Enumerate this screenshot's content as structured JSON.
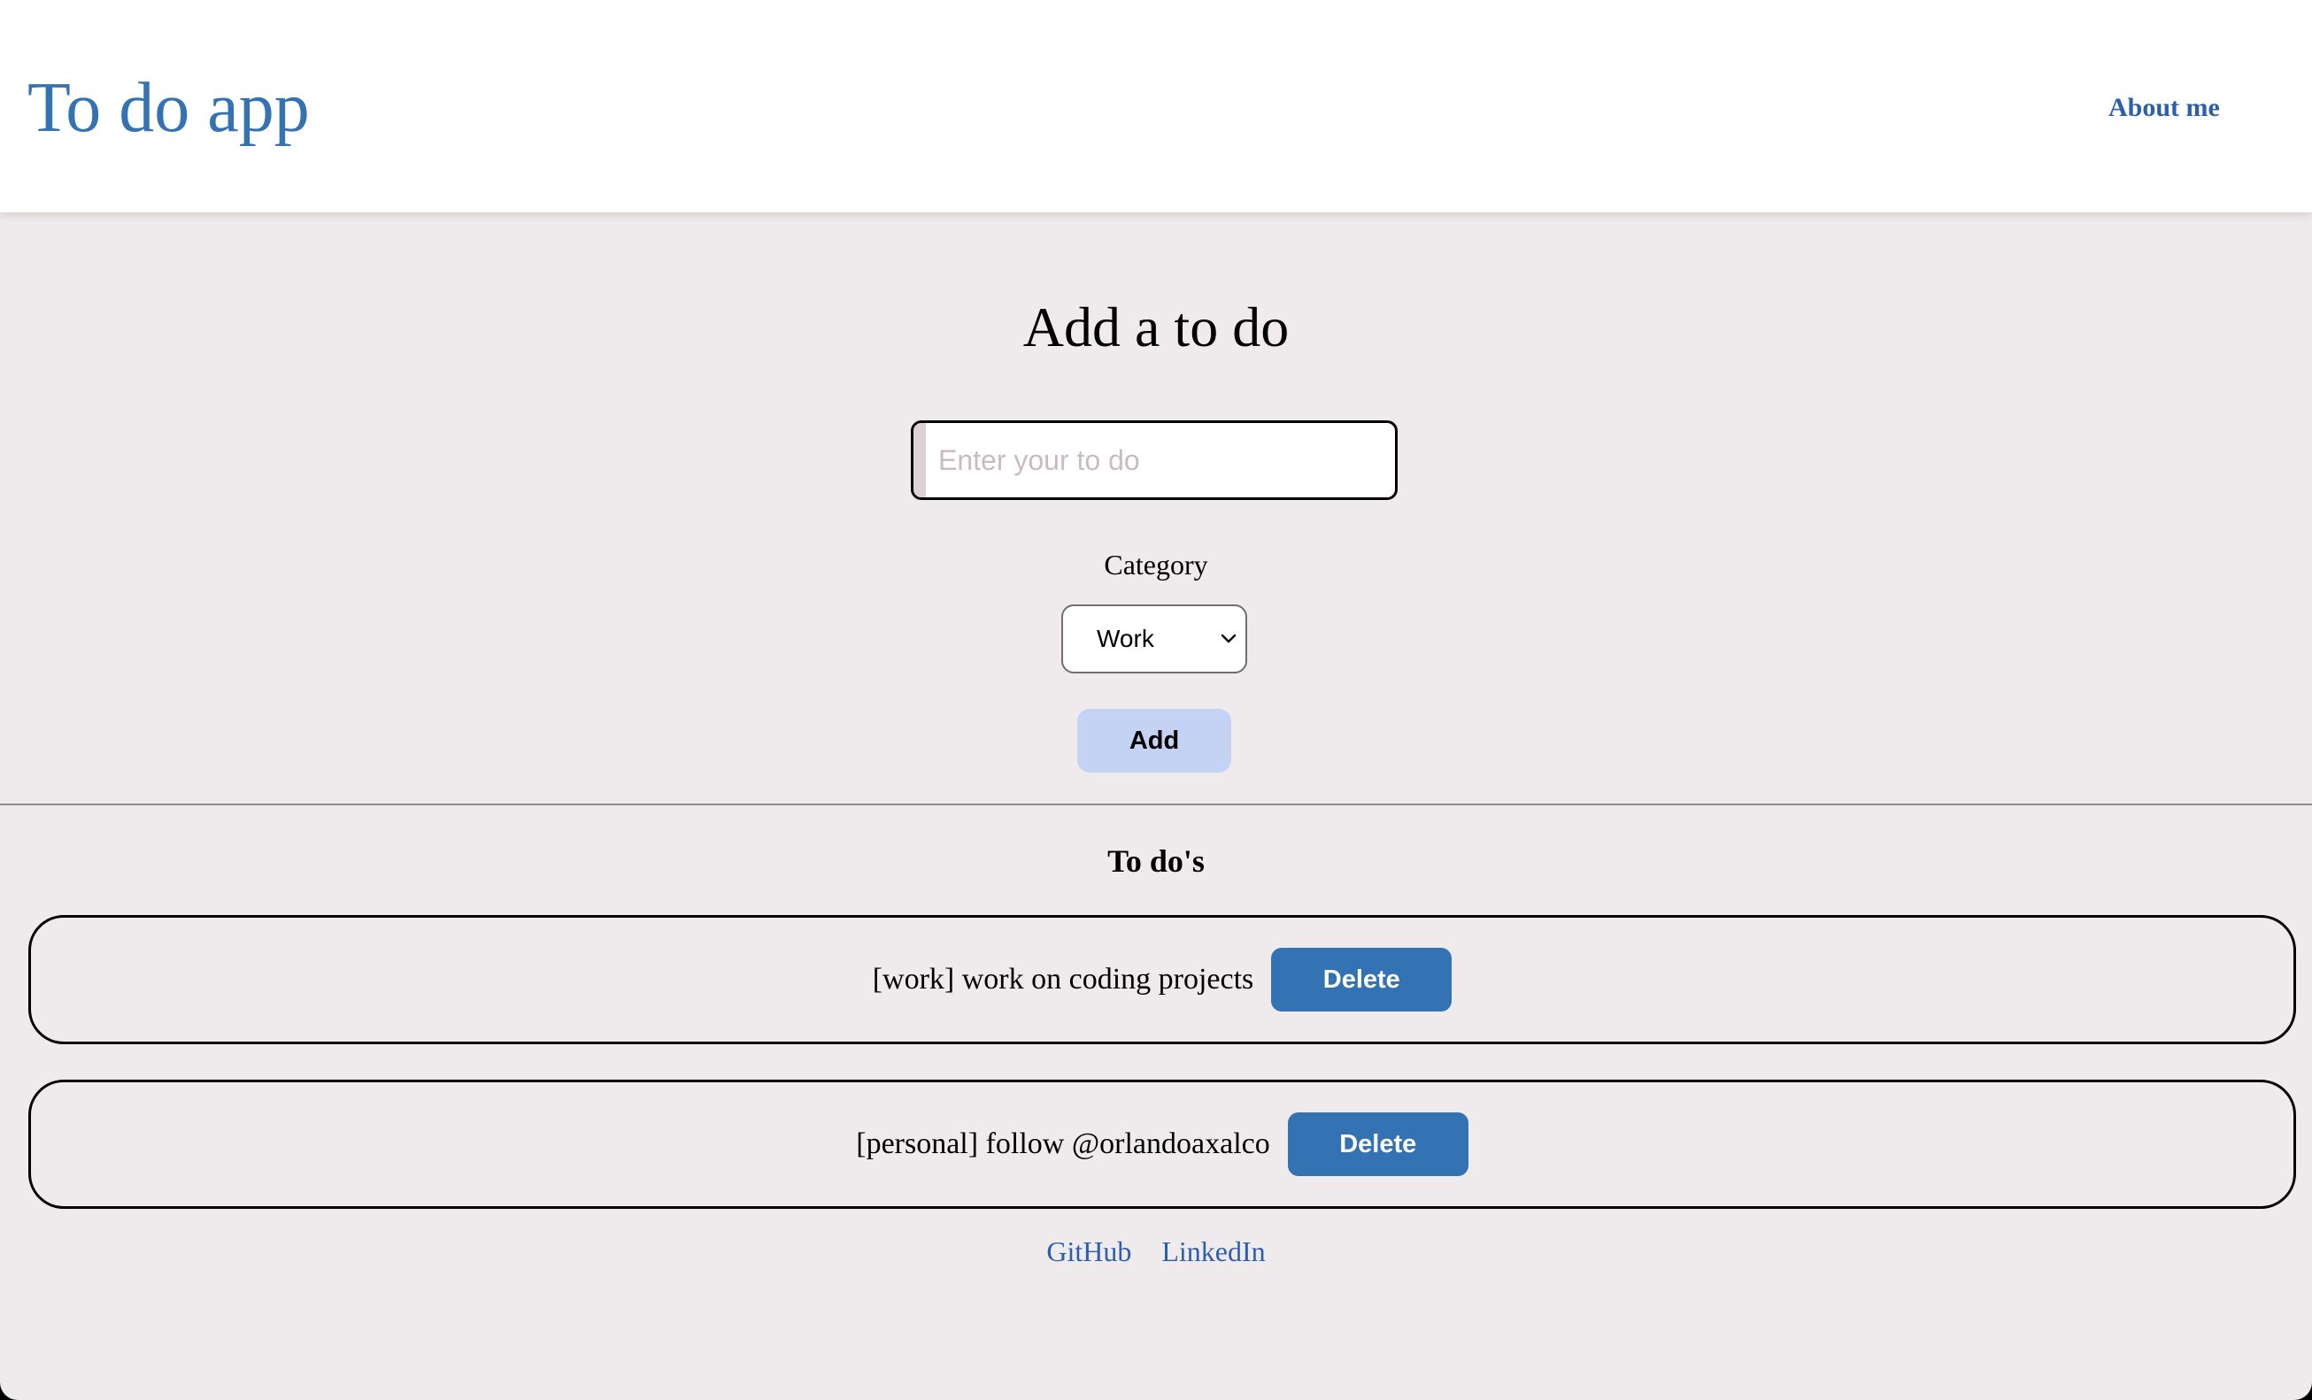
{
  "header": {
    "title": "To do app",
    "about_link": "About me"
  },
  "add_form": {
    "heading": "Add a to do",
    "todo_input": {
      "value": "",
      "placeholder": "Enter your to do"
    },
    "category_label": "Category",
    "category_select": {
      "selected": "Work"
    },
    "add_button": "Add"
  },
  "todos": {
    "heading": "To do's",
    "items": [
      {
        "text": "[work] work on coding projects",
        "delete_label": "Delete"
      },
      {
        "text": "[personal] follow @orlandoaxalco",
        "delete_label": "Delete"
      }
    ]
  },
  "footer": {
    "links": [
      "GitHub",
      "LinkedIn"
    ]
  },
  "colors": {
    "brand_blue": "#3473b3",
    "link_blue": "#2c5eaf",
    "add_button_bg": "#c4d3f4",
    "page_bg": "#efebec"
  }
}
